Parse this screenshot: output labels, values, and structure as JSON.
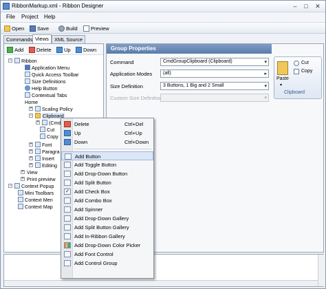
{
  "window": {
    "title": "RibbonMarkup.xml - Ribbon Designer",
    "min": "–",
    "max": "□",
    "close": "✕"
  },
  "menu": [
    "File",
    "Project",
    "Help"
  ],
  "toolbar": [
    "Open",
    "Save",
    "Build",
    "Preview"
  ],
  "tabs": [
    "Commands",
    "Views",
    "XML Source"
  ],
  "tree_toolbar": [
    "Add",
    "Delete",
    "Up",
    "Down"
  ],
  "tree": {
    "ribbon": "Ribbon",
    "application_menu": "Application Menu",
    "quick_access_toolbar": "Quick Access Toolbar",
    "size_definitions": "Size Definitions",
    "help_button": "Help Button",
    "contextual_tabs": "Contextual Tabs",
    "home": "Home",
    "scaling_policy": "Scaling Policy",
    "clipboard": "Clipboard",
    "cmd": "(CmdG",
    "cut": "Cut",
    "copy": "Copy",
    "font": "Font",
    "paragraph": "Paragra",
    "insert": "Insert",
    "editing": "Editing",
    "view": "View",
    "print_preview": "Print preview",
    "context_popup": "Context Popup",
    "mini_toolbars": "Mini Toolbars",
    "context_menus": "Context Men",
    "context_maps": "Context Map"
  },
  "group_properties": {
    "header": "Group Properties",
    "command_label": "Command",
    "command_value": "CmdGroupClipboard (Clipboard)",
    "app_modes_label": "Application Modes",
    "app_modes_value": "(all)",
    "size_def_label": "Size Definition",
    "size_def_value": "3 Buttons, 1 Big and 2 Small",
    "custom_size_label": "Custom Size Definition"
  },
  "preview": {
    "paste": "Paste",
    "cut": "Cut",
    "copy": "Copy",
    "group": "Clipboard"
  },
  "context_menu": {
    "delete": "Delete",
    "delete_sc": "Ctrl+Del",
    "up": "Up",
    "up_sc": "Ctrl+Up",
    "down": "Down",
    "down_sc": "Ctrl+Down",
    "items": [
      "Add Button",
      "Add Toggle Button",
      "Add Drop-Down Button",
      "Add Split Button",
      "Add Check Box",
      "Add Combo Box",
      "Add Spinner",
      "Add Drop-Down Gallery",
      "Add Split Button Gallery",
      "Add In-Ribbon Gallery",
      "Add Drop-Down Color Picker",
      "Add Font Control",
      "Add Control Group"
    ]
  }
}
